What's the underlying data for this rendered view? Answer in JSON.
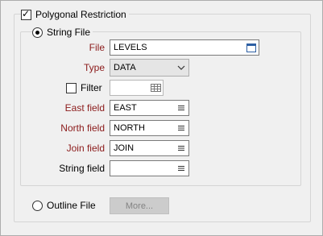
{
  "polygonal_restriction": {
    "label": "Polygonal Restriction",
    "checked": true
  },
  "string_file_option": {
    "label": "String File",
    "selected": true
  },
  "file": {
    "label": "File",
    "value": "LEVELS"
  },
  "type": {
    "label": "Type",
    "value": "DATA"
  },
  "filter": {
    "label": "Filter",
    "checked": false,
    "value": ""
  },
  "east_field": {
    "label": "East field",
    "value": "EAST"
  },
  "north_field": {
    "label": "North field",
    "value": "NORTH"
  },
  "join_field": {
    "label": "Join field",
    "value": "JOIN"
  },
  "string_field": {
    "label": "String field",
    "value": ""
  },
  "outline_file_option": {
    "label": "Outline File",
    "selected": false
  },
  "more_button": {
    "label": "More..."
  },
  "colors": {
    "required_label": "#8b1a1a",
    "border": "#adadad",
    "background": "#f0f0f0"
  },
  "icons": {
    "file_browse": "file-browse-icon",
    "type_dropdown": "chevron-down-icon",
    "filter_edit": "filter-grid-icon",
    "field_list": "list-icon"
  }
}
